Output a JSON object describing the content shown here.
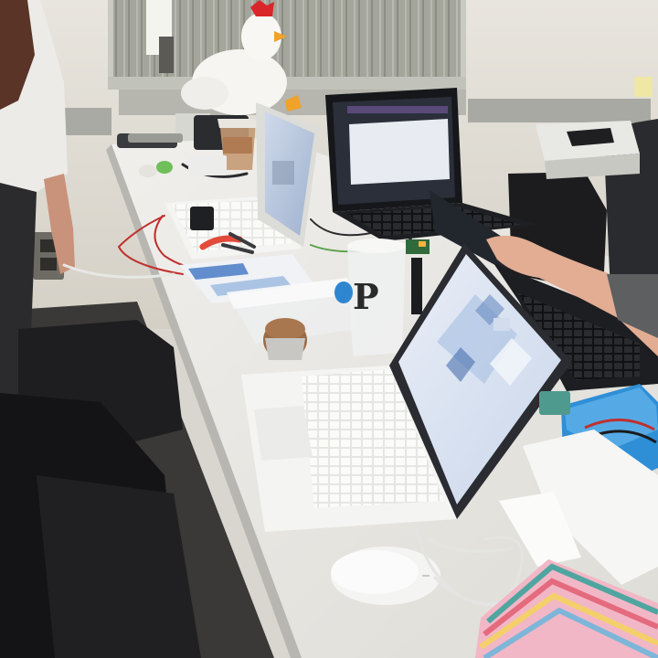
{
  "scene": {
    "cup_logo_letter": "P",
    "palette": {
      "wall": "#e4e1d9",
      "window_blinds": "#9d9e94",
      "desk": "#ecebe7",
      "floor": "#3b3a38",
      "laptop_white": "#f1f1ef",
      "laptop_black": "#1e1f22",
      "screen_blue": "#d9e4f4",
      "screen_dark": "#2b2f3a",
      "accent_orange": "#f0a22a",
      "box_blue": "#2f8fd6",
      "stripe_pink": "#f07ea1"
    }
  }
}
